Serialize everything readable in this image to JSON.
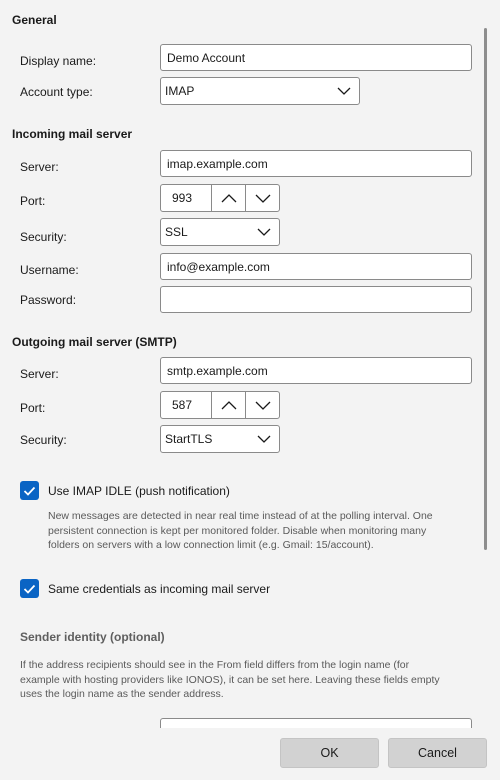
{
  "general": {
    "title": "General",
    "display_name_label": "Display name:",
    "display_name_value": "Demo Account",
    "account_type_label": "Account type:",
    "account_type_value": "IMAP"
  },
  "incoming": {
    "title": "Incoming mail server",
    "server_label": "Server:",
    "server_value": "imap.example.com",
    "port_label": "Port:",
    "port_value": "993",
    "security_label": "Security:",
    "security_value": "SSL",
    "username_label": "Username:",
    "username_value": "info@example.com",
    "password_label": "Password:",
    "password_value": ""
  },
  "outgoing": {
    "title": "Outgoing mail server (SMTP)",
    "server_label": "Server:",
    "server_value": "smtp.example.com",
    "port_label": "Port:",
    "port_value": "587",
    "security_label": "Security:",
    "security_value": "StartTLS"
  },
  "idle": {
    "checked": true,
    "label": "Use IMAP IDLE (push notification)",
    "help_lines": [
      "New messages are detected in near real time instead of at the polling interval. One",
      "persistent connection is kept per monitored folder. Disable when monitoring many",
      "folders on servers with a low connection limit (e.g. Gmail: 15/account)."
    ]
  },
  "same_credentials": {
    "checked": true,
    "label": "Same credentials as incoming mail server"
  },
  "sender_identity": {
    "title": "Sender identity (optional)",
    "help_lines": [
      "If the address recipients should see in the From field differs from the login name (for",
      "example with hosting providers like IONOS), it can be set here. Leaving these fields empty",
      "uses the login name as the sender address."
    ]
  },
  "footer": {
    "ok_label": "OK",
    "cancel_label": "Cancel"
  },
  "colors": {
    "accent": "#0a64c4",
    "background": "#f3f3f3"
  },
  "icons": {
    "dropdown": "chevron-down-icon",
    "increment": "chevron-up-icon",
    "decrement": "chevron-down-icon",
    "check": "checkmark-icon"
  }
}
